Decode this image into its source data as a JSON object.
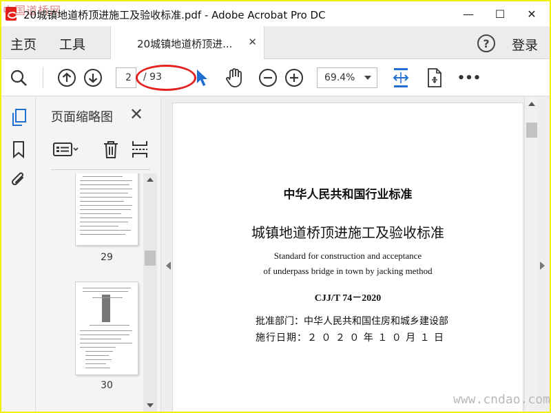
{
  "window": {
    "title": "20城镇地道桥顶进施工及验收标准.pdf - Adobe Acrobat Pro DC",
    "watermark_top": "中国道桥网",
    "min": "—",
    "max": "☐",
    "close": "✕"
  },
  "menu": {
    "home": "主页",
    "tools": "工具",
    "tab_label": "20城镇地道桥顶进...",
    "tab_close": "✕",
    "help": "?",
    "signin": "登录"
  },
  "toolbar": {
    "current_page": "2",
    "total_pages": "/ 93",
    "zoom": "69.4%",
    "more": "•••"
  },
  "panel": {
    "title": "页面缩略图",
    "close": "✕",
    "thumbnails": [
      {
        "number": "29"
      },
      {
        "number": "30"
      }
    ]
  },
  "document": {
    "org": "中华人民共和国行业标准",
    "title_cn": "城镇地道桥顶进施工及验收标准",
    "title_en_1": "Standard for construction and acceptance",
    "title_en_2": "of underpass bridge in town by jacking method",
    "code": "CJJ/T 74－2020",
    "approve": "批准部门：中华人民共和国住房和城乡建设部",
    "effective": "施行日期：２ ０ ２ ０ 年 １ ０ 月 １ 日"
  },
  "watermark_bottom": "www.cndao.com",
  "colors": {
    "accent_blue": "#1f6fd1",
    "annotation_red": "#e52020",
    "frame_yellow": "#f0f000"
  }
}
